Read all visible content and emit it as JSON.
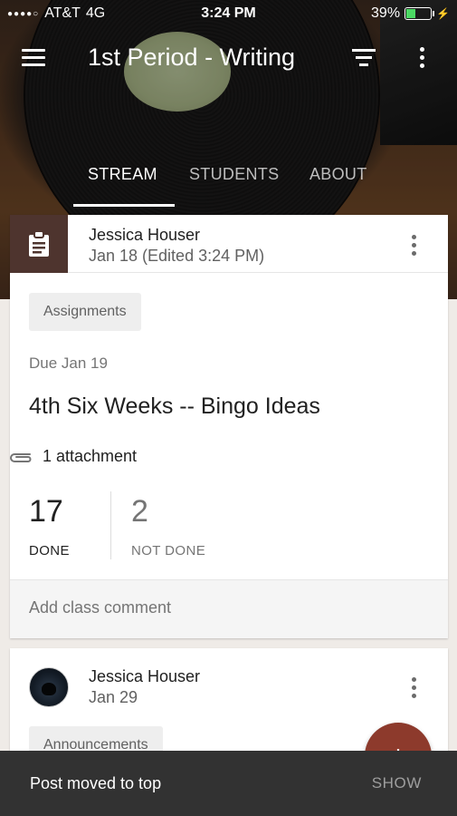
{
  "status_bar": {
    "carrier": "AT&T",
    "network": "4G",
    "time": "3:24 PM",
    "battery": "39%",
    "battery_level": 0.39
  },
  "header": {
    "class_title": "1st Period - Writing",
    "icons": [
      "menu-icon",
      "filter-icon",
      "more-vert-icon"
    ],
    "tabs": [
      {
        "label": "STREAM",
        "active": true
      },
      {
        "label": "STUDENTS",
        "active": false
      },
      {
        "label": "ABOUT",
        "active": false
      }
    ]
  },
  "posts": [
    {
      "author": "Jessica Houser",
      "date": "Jan 18 (Edited 3:24 PM)",
      "topic": "Assignments",
      "due": "Due Jan 19",
      "title": "4th Six Weeks -- Bingo Ideas",
      "attachments": "1 attachment",
      "done_count": "17",
      "done_label": "DONE",
      "not_done_count": "2",
      "not_done_label": "NOT DONE",
      "comment_placeholder": "Add class comment"
    },
    {
      "author": "Jessica Houser",
      "date": "Jan 29",
      "topic": "Announcements"
    }
  ],
  "fab": {
    "label": "+"
  },
  "snackbar": {
    "message": "Post moved to top",
    "action": "SHOW"
  },
  "colors": {
    "assignment_icon_bg": "#4e342e",
    "fab": "#8d3a2c",
    "battery": "#4cd964"
  }
}
